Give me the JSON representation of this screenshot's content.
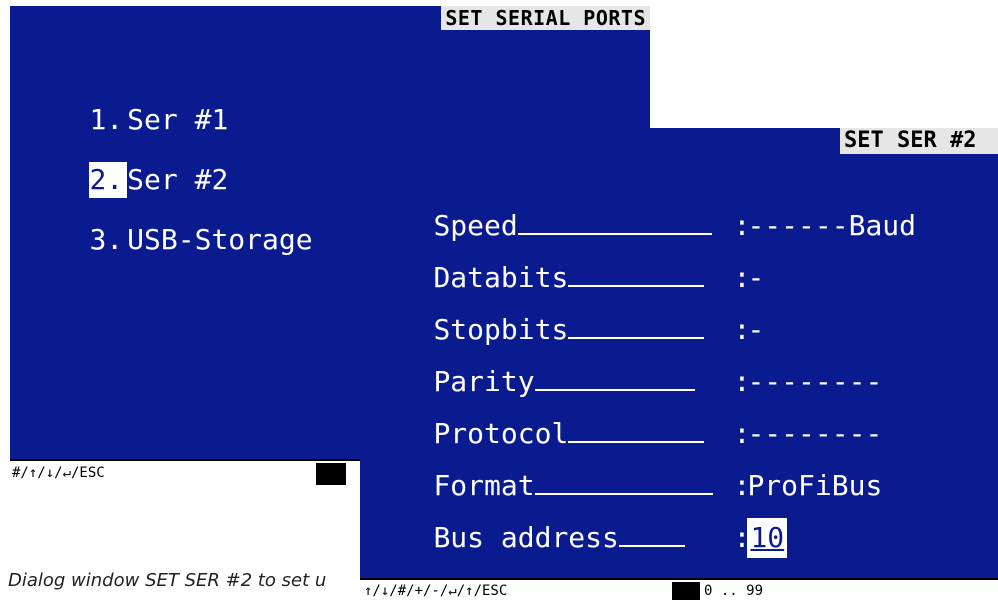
{
  "menu_screen": {
    "title": "SET SERIAL PORTS",
    "items": [
      {
        "num": "1.",
        "label": "Ser #1"
      },
      {
        "num": "2.",
        "label": "Ser #2"
      },
      {
        "num": "3.",
        "label": "USB-Storage"
      }
    ],
    "status": {
      "key_hints": "#/↑/↓/↵/ESC"
    }
  },
  "dialog_screen": {
    "title": "SET SER #2",
    "fields": [
      {
        "label": "Speed",
        "value": "------Baud"
      },
      {
        "label": "Databits",
        "value": "-"
      },
      {
        "label": "Stopbits",
        "value": "-"
      },
      {
        "label": "Parity",
        "value": "--------"
      },
      {
        "label": "Protocol",
        "value": "--------"
      },
      {
        "label": "Format",
        "value": "ProFiBus"
      },
      {
        "label": "Bus address",
        "value": "10"
      }
    ],
    "status": {
      "key_hints": "↑/↓/#/+/-/↵/↑/ESC",
      "range": "0 .. 99"
    }
  },
  "caption": "Dialog window SET SER #2 to set u",
  "colors": {
    "screen_background": "#0a1b8f",
    "title_background": "#e6e6e6",
    "text": "#ffffff"
  }
}
